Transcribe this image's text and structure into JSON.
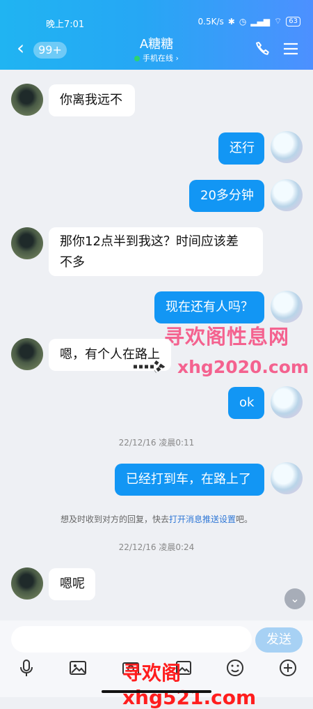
{
  "status": {
    "time": "晚上7:01",
    "network_speed": "0.5K/s",
    "battery": "63"
  },
  "header": {
    "unread_badge": "99+",
    "title": "A糖糖",
    "online_status": "手机在线 ›"
  },
  "messages": [
    {
      "side": "left",
      "text": "你离我远不"
    },
    {
      "side": "right",
      "text": "还行"
    },
    {
      "side": "right",
      "text": "20多分钟"
    },
    {
      "side": "left",
      "text": "那你12点半到我这？时间应该差不多",
      "line1": "那你12点半到我这？时间应该差",
      "line2": "不多"
    },
    {
      "side": "right",
      "text": "现在还有人吗？"
    },
    {
      "side": "left",
      "text": "嗯，有个人在路上"
    },
    {
      "side": "right",
      "text": "ok"
    },
    {
      "side": "right",
      "text": "已经打到车，在路上了"
    },
    {
      "side": "left",
      "text": "嗯呢"
    }
  ],
  "timestamps": [
    "22/12/16 凌晨0:11",
    "22/12/16 凌晨0:24"
  ],
  "notice": {
    "prefix": "想及时收到对方的回复，快去",
    "link": "打开消息推送设置",
    "suffix": "吧。"
  },
  "watermarks": {
    "top_chinese": "寻欢阁性息网",
    "top_domain": "xhg2020.com",
    "bottom": "寻欢阁xhg521.com"
  },
  "composer": {
    "input_value": "",
    "send_label": "发送"
  },
  "icons": {
    "back": "chevron-left-icon",
    "phone": "phone-icon",
    "menu": "menu-icon",
    "scroll": "chevron-down-icon",
    "toolbar": [
      "microphone-icon",
      "image-icon",
      "camera-icon",
      "photo-icon",
      "emoji-icon",
      "plus-icon"
    ]
  },
  "colors": {
    "header_gradient_start": "#20b4f2",
    "header_gradient_end": "#4d90ff",
    "outgoing_bubble": "#1296f4",
    "incoming_bubble": "#ffffff",
    "watermark_red": "#ff1d1d",
    "watermark_pink": "#f4497c"
  }
}
